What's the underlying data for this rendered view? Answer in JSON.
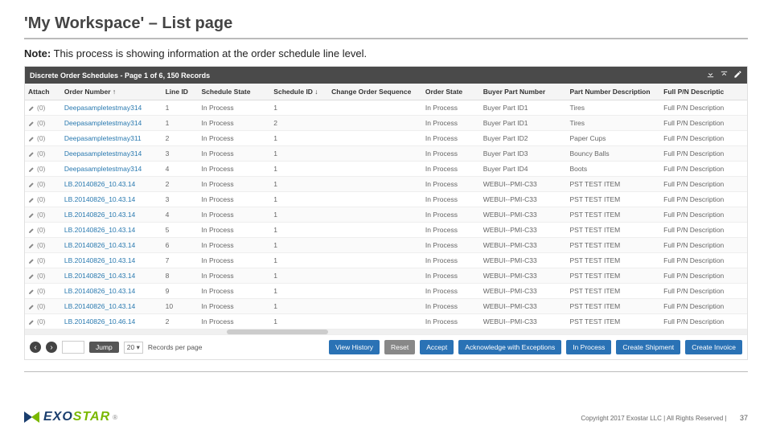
{
  "title": "'My Workspace' – List page",
  "note_label": "Note:",
  "note_text": " This process is showing information at the order schedule line level.",
  "panel_title": "Discrete Order Schedules - Page 1 of 6, 150 Records",
  "toolbar_icons": {
    "download": "download-icon",
    "upload": "upload-icon",
    "edit": "edit-icon"
  },
  "columns": [
    "Attach",
    "Order Number ↑",
    "Line ID",
    "Schedule State",
    "Schedule ID ↓",
    "Change Order Sequence",
    "Order State",
    "Buyer Part Number",
    "Part Number Description",
    "Full P/N Descriptic"
  ],
  "rows": [
    {
      "attach": "icons",
      "order": "Deepasampletestmay314",
      "line": "1",
      "sstate": "In Process",
      "sid": "1",
      "chg": "",
      "ostate": "In Process",
      "bpn": "Buyer Part ID1",
      "desc": "Tires",
      "full": "Full P/N Description"
    },
    {
      "attach": "icons",
      "order": "Deepasampletestmay314",
      "line": "1",
      "sstate": "In Process",
      "sid": "2",
      "chg": "",
      "ostate": "In Process",
      "bpn": "Buyer Part ID1",
      "desc": "Tires",
      "full": "Full P/N Description"
    },
    {
      "attach": "icons",
      "order": "Deepasampletestmay311",
      "line": "2",
      "sstate": "In Process",
      "sid": "1",
      "chg": "",
      "ostate": "In Process",
      "bpn": "Buyer Part ID2",
      "desc": "Paper Cups",
      "full": "Full P/N Description"
    },
    {
      "attach": "icons",
      "order": "Deepasampletestmay314",
      "line": "3",
      "sstate": "In Process",
      "sid": "1",
      "chg": "",
      "ostate": "In Process",
      "bpn": "Buyer Part ID3",
      "desc": "Bouncy Balls",
      "full": "Full P/N Description"
    },
    {
      "attach": "icons",
      "order": "Deepasampletestmay314",
      "line": "4",
      "sstate": "In Process",
      "sid": "1",
      "chg": "",
      "ostate": "In Process",
      "bpn": "Buyer Part ID4",
      "desc": "Boots",
      "full": "Full P/N Description"
    },
    {
      "attach": "icons",
      "order": "LB.20140826_10.43.14",
      "line": "2",
      "sstate": "In Process",
      "sid": "1",
      "chg": "",
      "ostate": "In Process",
      "bpn": "WEBUI--PMI-C33",
      "desc": "PST TEST ITEM",
      "full": "Full P/N Description"
    },
    {
      "attach": "icons",
      "order": "LB.20140826_10.43.14",
      "line": "3",
      "sstate": "In Process",
      "sid": "1",
      "chg": "",
      "ostate": "In Process",
      "bpn": "WEBUI--PMI-C33",
      "desc": "PST TEST ITEM",
      "full": "Full P/N Description"
    },
    {
      "attach": "icons",
      "order": "LB.20140826_10.43.14",
      "line": "4",
      "sstate": "In Process",
      "sid": "1",
      "chg": "",
      "ostate": "In Process",
      "bpn": "WEBUI--PMI-C33",
      "desc": "PST TEST ITEM",
      "full": "Full P/N Description"
    },
    {
      "attach": "icons",
      "order": "LB.20140826_10.43.14",
      "line": "5",
      "sstate": "In Process",
      "sid": "1",
      "chg": "",
      "ostate": "In Process",
      "bpn": "WEBUI--PMI-C33",
      "desc": "PST TEST ITEM",
      "full": "Full P/N Description"
    },
    {
      "attach": "icons",
      "order": "LB.20140826_10.43.14",
      "line": "6",
      "sstate": "In Process",
      "sid": "1",
      "chg": "",
      "ostate": "In Process",
      "bpn": "WEBUI--PMI-C33",
      "desc": "PST TEST ITEM",
      "full": "Full P/N Description"
    },
    {
      "attach": "icons",
      "order": "LB.20140826_10.43.14",
      "line": "7",
      "sstate": "In Process",
      "sid": "1",
      "chg": "",
      "ostate": "In Process",
      "bpn": "WEBUI--PMI-C33",
      "desc": "PST TEST ITEM",
      "full": "Full P/N Description"
    },
    {
      "attach": "icons",
      "order": "LB.20140826_10.43.14",
      "line": "8",
      "sstate": "In Process",
      "sid": "1",
      "chg": "",
      "ostate": "In Process",
      "bpn": "WEBUI--PMI-C33",
      "desc": "PST TEST ITEM",
      "full": "Full P/N Description"
    },
    {
      "attach": "icons",
      "order": "LB.20140826_10.43.14",
      "line": "9",
      "sstate": "In Process",
      "sid": "1",
      "chg": "",
      "ostate": "In Process",
      "bpn": "WEBUI--PMI-C33",
      "desc": "PST TEST ITEM",
      "full": "Full P/N Description"
    },
    {
      "attach": "icons",
      "order": "LB.20140826_10.43.14",
      "line": "10",
      "sstate": "In Process",
      "sid": "1",
      "chg": "",
      "ostate": "In Process",
      "bpn": "WEBUI--PMI-C33",
      "desc": "PST TEST ITEM",
      "full": "Full P/N Description"
    },
    {
      "attach": "icons",
      "order": "LB.20140826_10.46.14",
      "line": "2",
      "sstate": "In Process",
      "sid": "1",
      "chg": "",
      "ostate": "In Process",
      "bpn": "WEBUI--PMI-C33",
      "desc": "PST TEST ITEM",
      "full": "Full P/N Description"
    }
  ],
  "pager": {
    "jump": "Jump",
    "pagesize": "20 ▾",
    "rpp": "Records per page"
  },
  "actions": {
    "view_history": "View History",
    "reset": "Reset",
    "accept": "Accept",
    "ack_exceptions": "Acknowledge with Exceptions",
    "in_process": "In Process",
    "create_shipment": "Create Shipment",
    "create_invoice": "Create Invoice"
  },
  "logo": {
    "brand_left": "EXO",
    "brand_right": "STAR"
  },
  "copyright": "Copyright 2017 Exostar LLC | All Rights Reserved |",
  "page_number": "37"
}
